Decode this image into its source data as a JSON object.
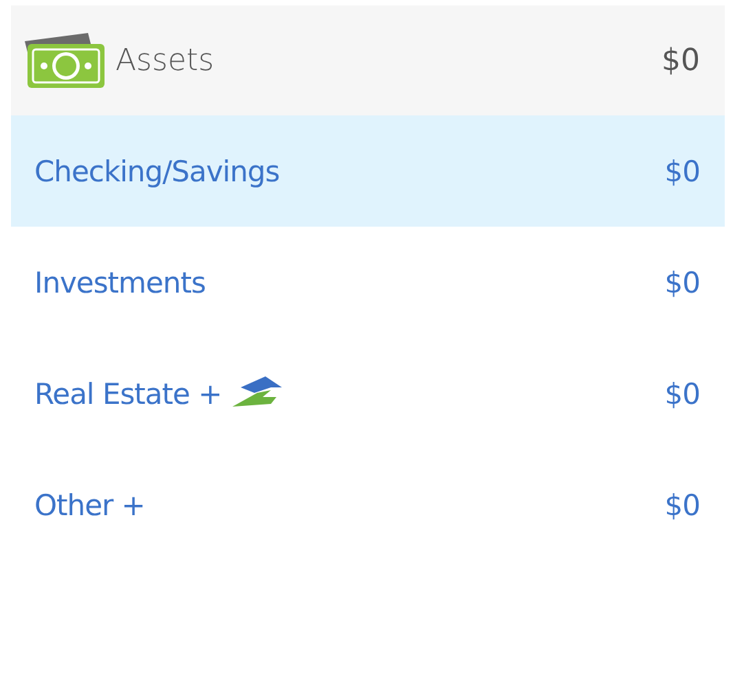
{
  "header": {
    "title": "Assets",
    "total": "$0"
  },
  "items": [
    {
      "label": "Checking/Savings",
      "amount": "$0",
      "selected": true,
      "kind": "plain"
    },
    {
      "label": "Investments",
      "amount": "$0",
      "selected": false,
      "kind": "plain"
    },
    {
      "label": "Real Estate +",
      "amount": "$0",
      "selected": false,
      "kind": "house"
    },
    {
      "label": "Other +",
      "amount": "$0",
      "selected": false,
      "kind": "plain"
    }
  ]
}
